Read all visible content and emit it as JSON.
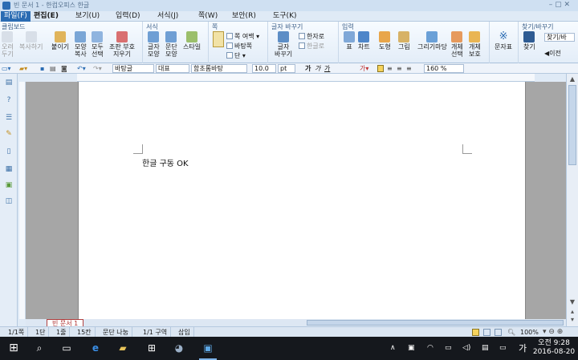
{
  "window": {
    "title": "빈 문서 1 - 한컴오피스 한글"
  },
  "menus": [
    {
      "label": "파일(F)",
      "active": true
    },
    {
      "label": "편집(E)"
    },
    {
      "label": "보기(U)"
    },
    {
      "label": "입력(D)"
    },
    {
      "label": "서식(J)"
    },
    {
      "label": "쪽(W)"
    },
    {
      "label": "보안(R)"
    },
    {
      "label": "도구(K)"
    }
  ],
  "ribbon": {
    "clipboard": {
      "title": "클립보드",
      "cut": "오려\n두기",
      "copy": "복사하기",
      "paste": "붙이기",
      "format_copy": "모양\n복사",
      "select_all": "모두\n선택",
      "cond_delete": "조판 부호\n지우기"
    },
    "format": {
      "title": "서식",
      "char_shape": "글자\n모양",
      "para_shape": "문단\n모양",
      "style": "스타일"
    },
    "page": {
      "title": "쪽",
      "margin": "쪽 여백",
      "background": "바탕쪽",
      "columns": "단"
    },
    "convert": {
      "title": "글자 바꾸기",
      "convert_btn": "글자\n바꾸기",
      "hanja": "한자로",
      "hangul": "한글로"
    },
    "input": {
      "title": "입력",
      "table": "표",
      "chart": "차트",
      "shape": "도형",
      "picture": "그림",
      "draw": "그리기마당",
      "obj_select": "개체\n선택",
      "obj_protect": "개체\n보호"
    },
    "symbols": {
      "label": "문자표"
    },
    "find": {
      "title": "찾기/바꾸기",
      "find": "찾기",
      "replace_box": "찾기/바",
      "prev": "이전"
    }
  },
  "formatbar": {
    "style": "바탕글",
    "lang": "대표",
    "font": "함초롬바탕",
    "size": "10.0",
    "unit": "pt",
    "bold": "가",
    "italic": "가",
    "underline": "가",
    "zoom": "160 %"
  },
  "document": {
    "body_text": "한글 구동 OK",
    "tab_label": "빈 문서 1"
  },
  "status": {
    "page": "1/1쪽",
    "section": "1단",
    "line": "1줄",
    "column": "15칸",
    "para": "문단 나눔",
    "zone": "1/1 구역",
    "insert": "삽입",
    "zoom": "100%"
  },
  "taskbar": {
    "time": "오전 9:28",
    "date": "2016-08-20",
    "ime": "가"
  },
  "colors": {
    "accent": "#2b6cb3",
    "title_bg": "#cfe0f2",
    "taskbar": "#15181d"
  }
}
